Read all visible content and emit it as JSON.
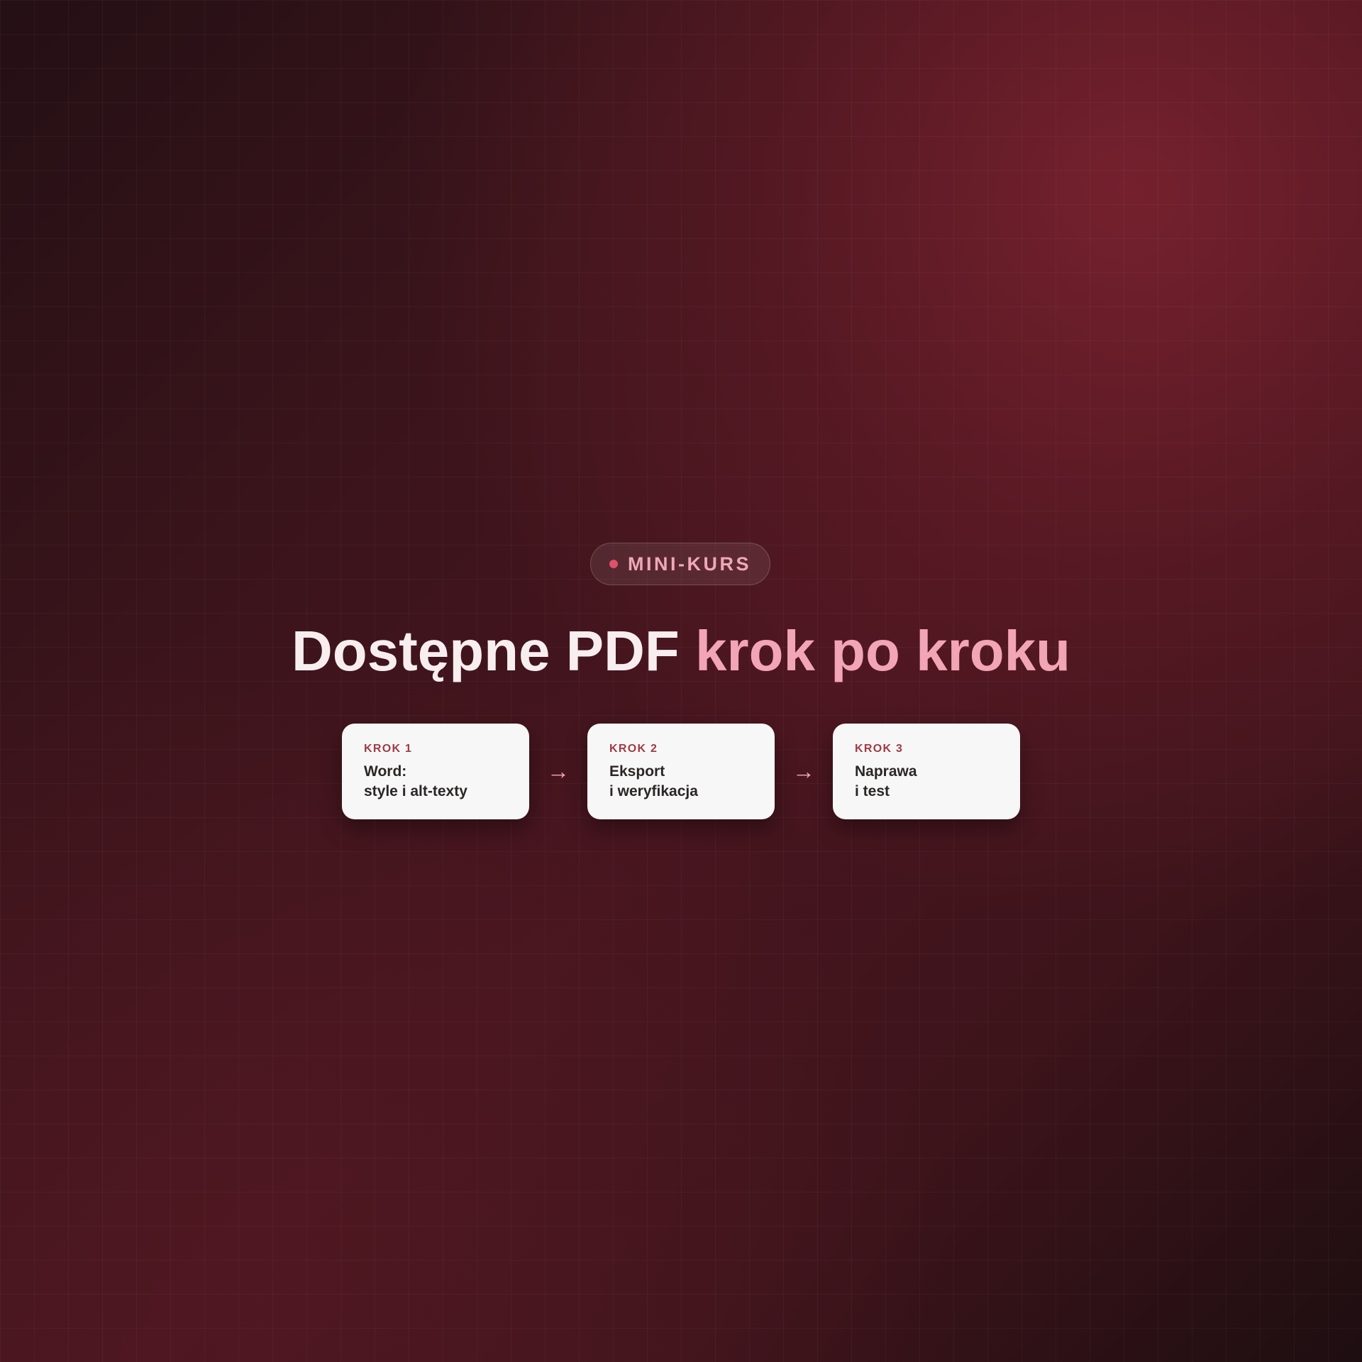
{
  "badge": {
    "label": "MINI-KURS"
  },
  "headline": {
    "main": "Dostępne PDF",
    "accent": "krok po kroku"
  },
  "steps": [
    {
      "step": "KROK 1",
      "line1": "Word:",
      "line2": "style i alt-texty"
    },
    {
      "step": "KROK 2",
      "line1": "Eksport",
      "line2": "i weryfikacja"
    },
    {
      "step": "KROK 3",
      "line1": "Naprawa",
      "line2": "i test"
    }
  ],
  "arrow_icon": "arrow-right-icon",
  "colors": {
    "accent": "#f2a5b5",
    "badge_dot": "#e0506a",
    "step_label": "#a13a45",
    "background": "#3a151c"
  }
}
